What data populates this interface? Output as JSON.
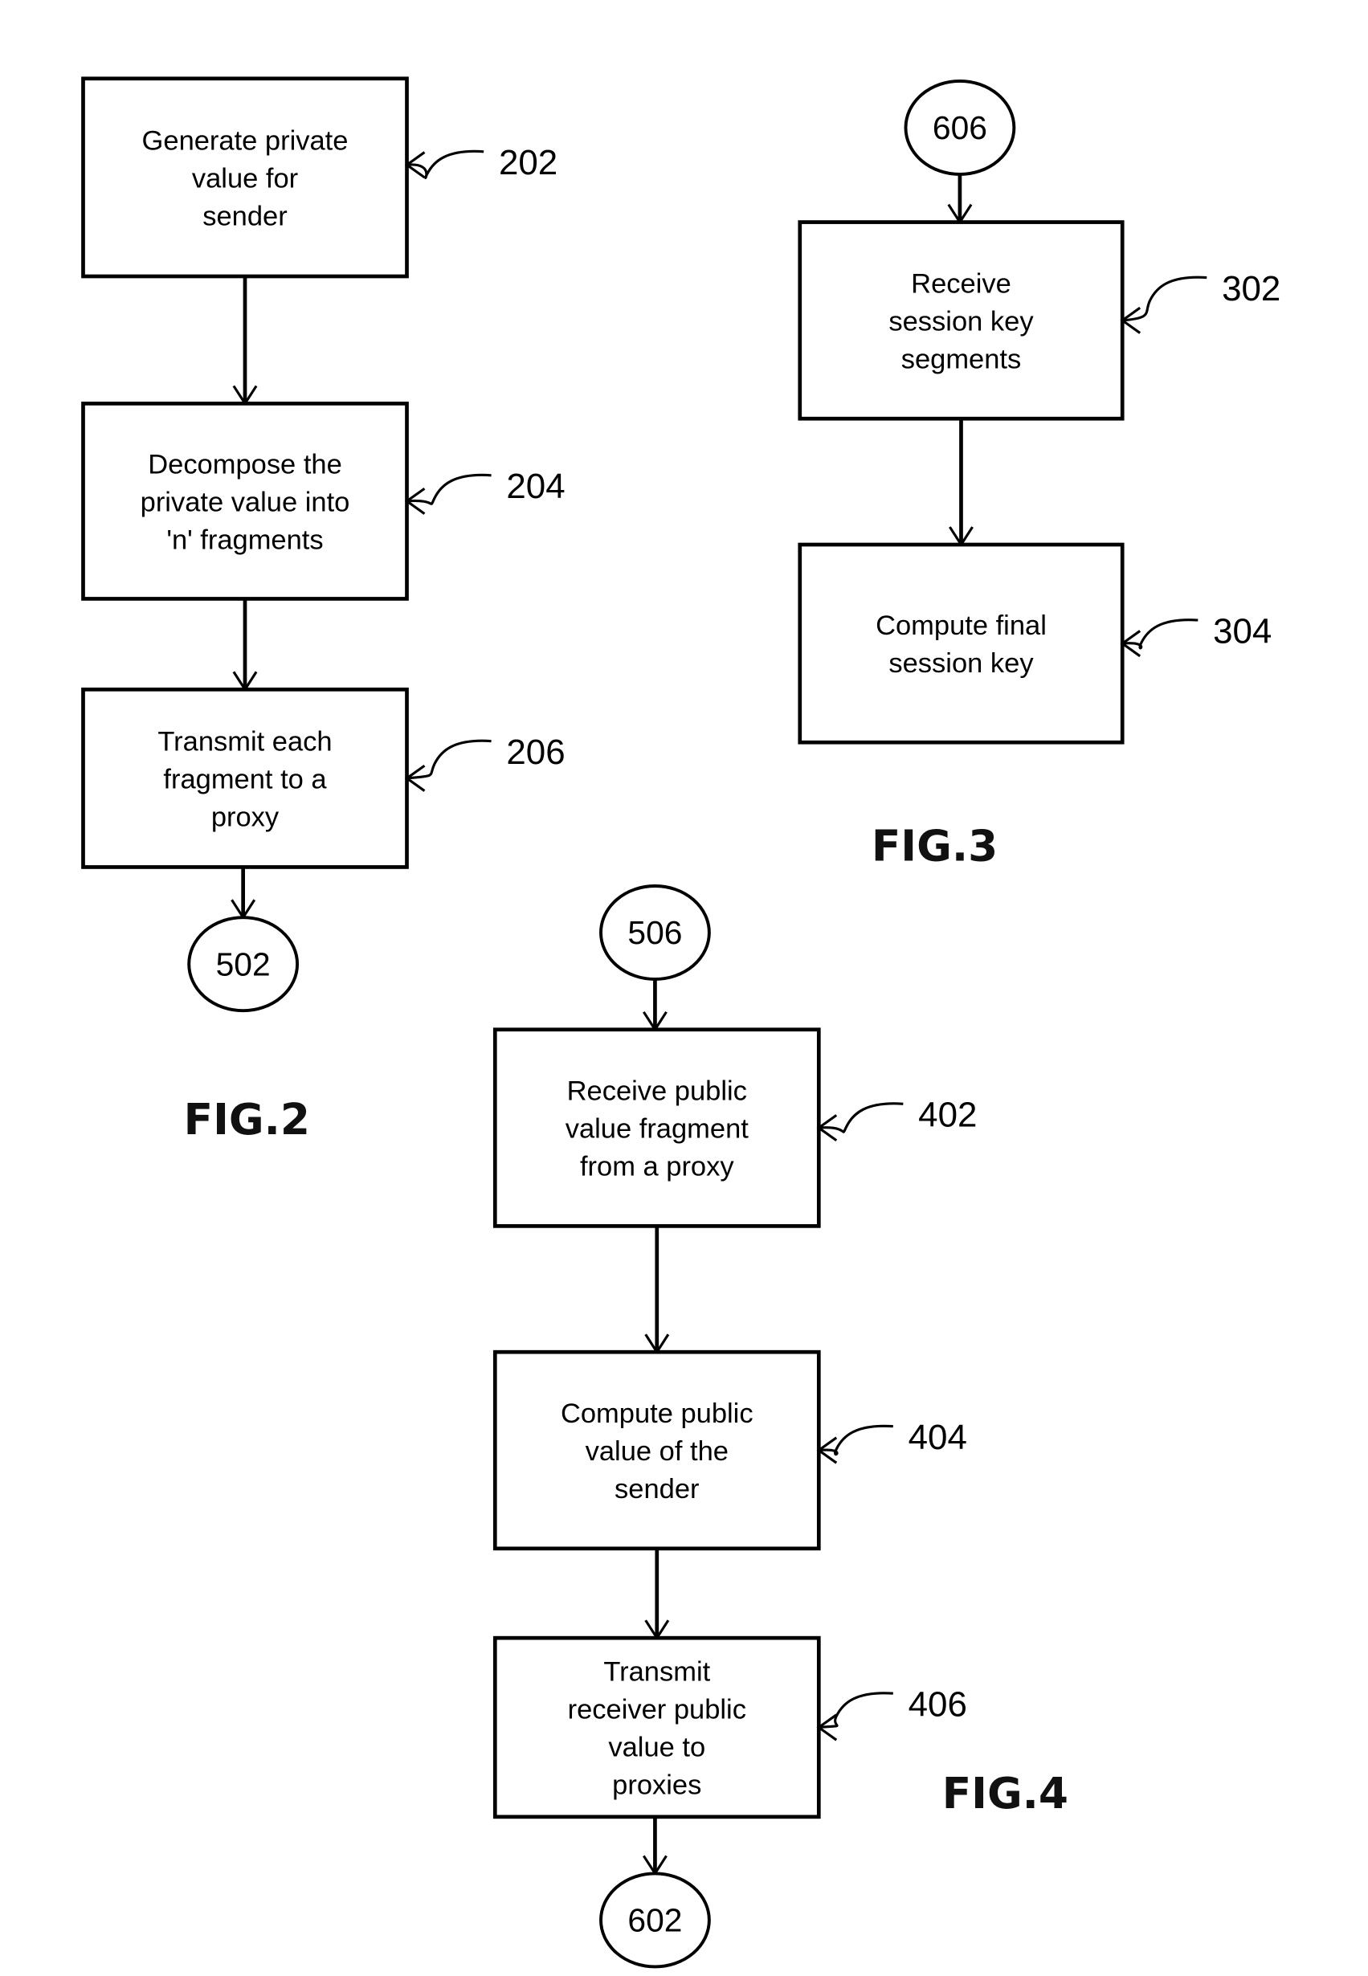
{
  "figures": [
    {
      "label": "FIG.2",
      "steps": [
        {
          "ref": "202",
          "lines": [
            "Generate private",
            "value for",
            "sender"
          ]
        },
        {
          "ref": "204",
          "lines": [
            "Decompose the",
            "private value into",
            "'n' fragments"
          ]
        },
        {
          "ref": "206",
          "lines": [
            "Transmit each",
            "fragment to a",
            "proxy"
          ]
        }
      ],
      "connector_out": "502"
    },
    {
      "label": "FIG.3",
      "connector_in": "606",
      "steps": [
        {
          "ref": "302",
          "lines": [
            "Receive",
            "session key",
            "segments"
          ]
        },
        {
          "ref": "304",
          "lines": [
            "Compute final",
            "session key"
          ]
        }
      ]
    },
    {
      "label": "FIG.4",
      "connector_in": "506",
      "steps": [
        {
          "ref": "402",
          "lines": [
            "Receive public",
            "value fragment",
            "from a proxy"
          ]
        },
        {
          "ref": "404",
          "lines": [
            "Compute public",
            "value of the",
            "sender"
          ]
        },
        {
          "ref": "406",
          "lines": [
            "Transmit",
            "receiver public",
            "value to",
            "proxies"
          ]
        }
      ],
      "connector_out": "602"
    }
  ]
}
